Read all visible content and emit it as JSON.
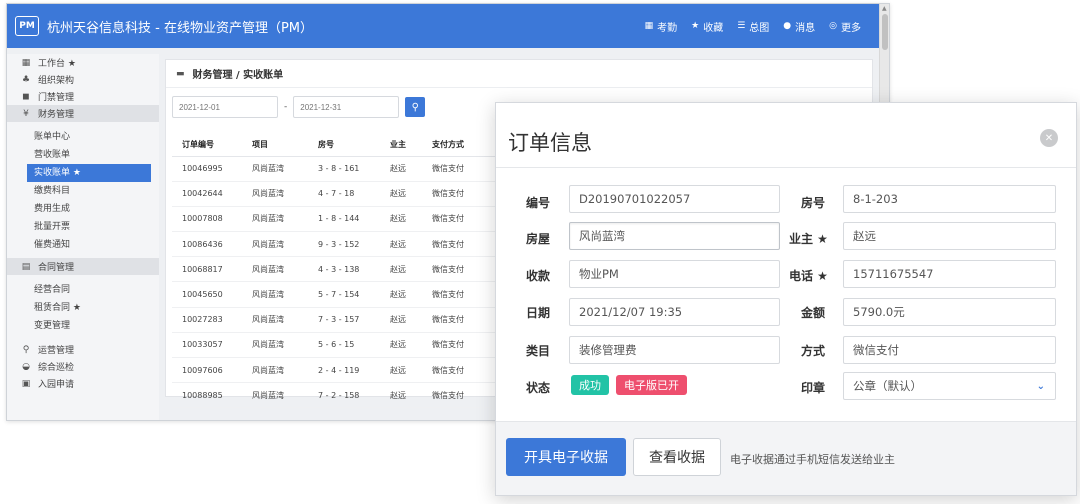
{
  "app": {
    "logo": "PM",
    "title": "杭州天谷信息科技 - 在线物业资产管理（PM）",
    "top_nav": [
      {
        "icon": "grid-icon",
        "glyph": "▦",
        "label": "考勤"
      },
      {
        "icon": "star-icon",
        "glyph": "★",
        "label": "收藏"
      },
      {
        "icon": "list-icon",
        "glyph": "☰",
        "label": "总图"
      },
      {
        "icon": "chat-icon",
        "glyph": "●",
        "label": "消息"
      },
      {
        "icon": "more-icon",
        "glyph": "◎",
        "label": "更多"
      }
    ]
  },
  "sidebar": {
    "s1": {
      "glyph": "▦",
      "label": "工作台 ★"
    },
    "s2": {
      "glyph": "♣",
      "label": "组织架构"
    },
    "s3": {
      "glyph": "◼",
      "label": "门禁管理"
    },
    "s4": {
      "glyph": "¥",
      "label": "财务管理"
    },
    "finance_items": [
      "账单中心",
      "营收账单",
      "实收账单 ★",
      "缴费科目",
      "费用生成",
      "批量开票",
      "催费通知"
    ],
    "s5": {
      "glyph": "▤",
      "label": "合同管理"
    },
    "contract_items": [
      "经营合同",
      "租赁合同 ★",
      "变更管理"
    ],
    "s6": {
      "glyph": "⚲",
      "label": "运营管理"
    },
    "s7": {
      "glyph": "◒",
      "label": "综合巡检"
    },
    "s8": {
      "glyph": "▣",
      "label": "入园申请"
    }
  },
  "content": {
    "breadcrumb": "财务管理 / 实收账单",
    "start_date_placeholder": "2021-12-01",
    "end_date_placeholder": "2021-12-31",
    "dash": "-",
    "table": {
      "headers": [
        "订单编号",
        "项目",
        "房号",
        "业主",
        "支付方式"
      ],
      "rows": [
        [
          "10046995",
          "风尚蓝湾",
          "3 - 8 - 161",
          "赵远",
          "微信支付"
        ],
        [
          "10042644",
          "风尚蓝湾",
          "4 - 7 - 18",
          "赵远",
          "微信支付"
        ],
        [
          "10007808",
          "风尚蓝湾",
          "1 - 8 - 144",
          "赵远",
          "微信支付"
        ],
        [
          "10086436",
          "风尚蓝湾",
          "9 - 3 - 152",
          "赵远",
          "微信支付"
        ],
        [
          "10068817",
          "风尚蓝湾",
          "4 - 3 - 138",
          "赵远",
          "微信支付"
        ],
        [
          "10045650",
          "风尚蓝湾",
          "5 - 7 - 154",
          "赵远",
          "微信支付"
        ],
        [
          "10027283",
          "风尚蓝湾",
          "7 - 3 - 157",
          "赵远",
          "微信支付"
        ],
        [
          "10033057",
          "风尚蓝湾",
          "5 - 6 - 15",
          "赵远",
          "微信支付"
        ],
        [
          "10097606",
          "风尚蓝湾",
          "2 - 4 - 119",
          "赵远",
          "微信支付"
        ],
        [
          "10088985",
          "风尚蓝湾",
          "7 - 2 - 158",
          "赵远",
          "微信支付"
        ]
      ]
    }
  },
  "modal": {
    "title": "订单信息",
    "close_glyph": "✕",
    "fields": {
      "number": {
        "label": "编号",
        "value": "D20190701022057"
      },
      "house": {
        "label": "房屋",
        "value": "风尚蓝湾"
      },
      "payee": {
        "label": "收款",
        "value": "物业PM"
      },
      "date": {
        "label": "日期",
        "value": "2021/12/07 19:35"
      },
      "category": {
        "label": "类目",
        "value": "装修管理费"
      },
      "status": {
        "label": "状态"
      },
      "room": {
        "label": "房号",
        "value": "8-1-203"
      },
      "owner": {
        "label": "业主 ★",
        "value": "赵远"
      },
      "phone": {
        "label": "电话 ★",
        "value": "15711675547"
      },
      "amount": {
        "label": "金额",
        "value": "5790.0元"
      },
      "method": {
        "label": "方式",
        "value": "微信支付"
      },
      "seal": {
        "label": "印章",
        "value": "公章（默认）"
      }
    },
    "badges": {
      "success": {
        "label": "成功",
        "color": "#22c3a6"
      },
      "einvoice": {
        "label": "电子版已开",
        "color": "#ee4f6e"
      }
    },
    "buttons": {
      "issue_receipt": "开具电子收据",
      "view_receipt": "查看收据"
    },
    "footer_note": "电子收据通过手机短信发送给业主"
  }
}
